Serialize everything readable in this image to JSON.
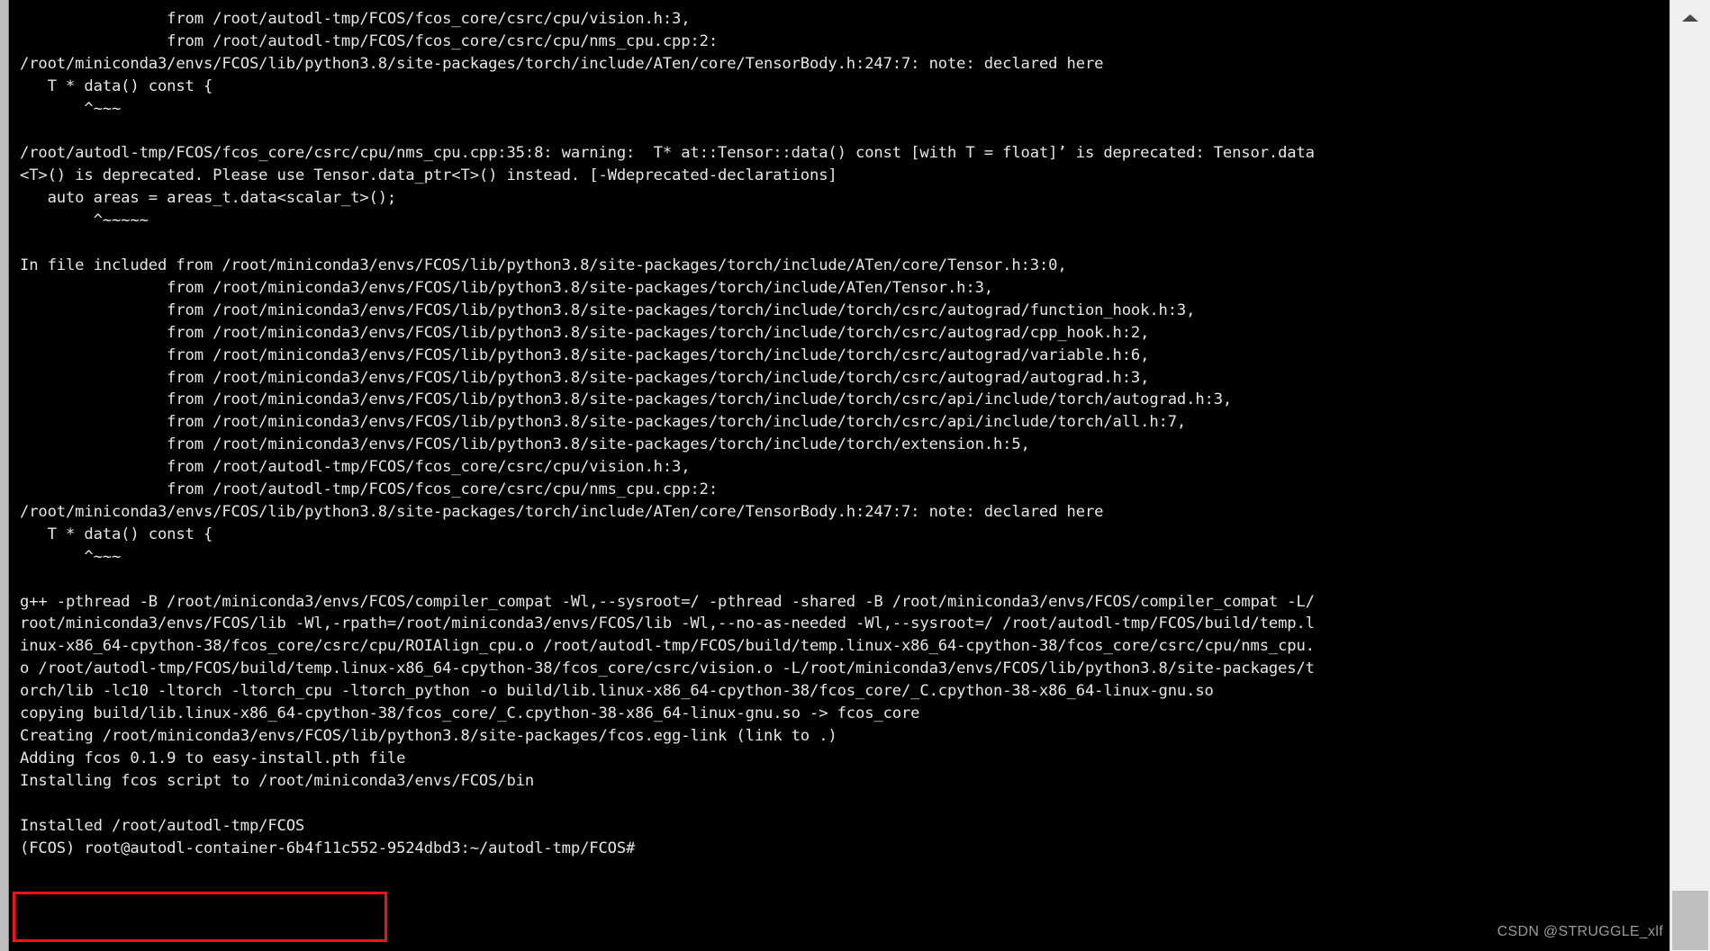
{
  "window": {
    "background_color": "#000000",
    "foreground_color": "#e6e6e6",
    "chrome_color": "#c0c0c0"
  },
  "scrollbar": {
    "up_arrow_label": "▲",
    "thumb_color": "#bfbfbf",
    "track_color": "#f0f0f0"
  },
  "annotation": {
    "color": "#fb0f0f",
    "target_text": "Installed /root/autodl-tmp/FCOS"
  },
  "watermark": {
    "text": "CSDN @STRUGGLE_xlf"
  },
  "terminal": {
    "lines": [
      "                from /root/autodl-tmp/FCOS/fcos_core/csrc/cpu/vision.h:3,",
      "                from /root/autodl-tmp/FCOS/fcos_core/csrc/cpu/nms_cpu.cpp:2:",
      "/root/miniconda3/envs/FCOS/lib/python3.8/site-packages/torch/include/ATen/core/TensorBody.h:247:7: note: declared here",
      "   T * data() const {",
      "       ^~~~",
      "",
      "/root/autodl-tmp/FCOS/fcos_core/csrc/cpu/nms_cpu.cpp:35:8: warning:  T* at::Tensor::data() const [with T = float]’ is deprecated: Tensor.data",
      "<T>() is deprecated. Please use Tensor.data_ptr<T>() instead. [-Wdeprecated-declarations]",
      "   auto areas = areas_t.data<scalar_t>();",
      "        ^~~~~~",
      "",
      "In file included from /root/miniconda3/envs/FCOS/lib/python3.8/site-packages/torch/include/ATen/core/Tensor.h:3:0,",
      "                from /root/miniconda3/envs/FCOS/lib/python3.8/site-packages/torch/include/ATen/Tensor.h:3,",
      "                from /root/miniconda3/envs/FCOS/lib/python3.8/site-packages/torch/include/torch/csrc/autograd/function_hook.h:3,",
      "                from /root/miniconda3/envs/FCOS/lib/python3.8/site-packages/torch/include/torch/csrc/autograd/cpp_hook.h:2,",
      "                from /root/miniconda3/envs/FCOS/lib/python3.8/site-packages/torch/include/torch/csrc/autograd/variable.h:6,",
      "                from /root/miniconda3/envs/FCOS/lib/python3.8/site-packages/torch/include/torch/csrc/autograd/autograd.h:3,",
      "                from /root/miniconda3/envs/FCOS/lib/python3.8/site-packages/torch/include/torch/csrc/api/include/torch/autograd.h:3,",
      "                from /root/miniconda3/envs/FCOS/lib/python3.8/site-packages/torch/include/torch/csrc/api/include/torch/all.h:7,",
      "                from /root/miniconda3/envs/FCOS/lib/python3.8/site-packages/torch/include/torch/extension.h:5,",
      "                from /root/autodl-tmp/FCOS/fcos_core/csrc/cpu/vision.h:3,",
      "                from /root/autodl-tmp/FCOS/fcos_core/csrc/cpu/nms_cpu.cpp:2:",
      "/root/miniconda3/envs/FCOS/lib/python3.8/site-packages/torch/include/ATen/core/TensorBody.h:247:7: note: declared here",
      "   T * data() const {",
      "       ^~~~",
      "",
      "g++ -pthread -B /root/miniconda3/envs/FCOS/compiler_compat -Wl,--sysroot=/ -pthread -shared -B /root/miniconda3/envs/FCOS/compiler_compat -L/",
      "root/miniconda3/envs/FCOS/lib -Wl,-rpath=/root/miniconda3/envs/FCOS/lib -Wl,--no-as-needed -Wl,--sysroot=/ /root/autodl-tmp/FCOS/build/temp.l",
      "inux-x86_64-cpython-38/fcos_core/csrc/cpu/ROIAlign_cpu.o /root/autodl-tmp/FCOS/build/temp.linux-x86_64-cpython-38/fcos_core/csrc/cpu/nms_cpu.",
      "o /root/autodl-tmp/FCOS/build/temp.linux-x86_64-cpython-38/fcos_core/csrc/vision.o -L/root/miniconda3/envs/FCOS/lib/python3.8/site-packages/t",
      "orch/lib -lc10 -ltorch -ltorch_cpu -ltorch_python -o build/lib.linux-x86_64-cpython-38/fcos_core/_C.cpython-38-x86_64-linux-gnu.so",
      "copying build/lib.linux-x86_64-cpython-38/fcos_core/_C.cpython-38-x86_64-linux-gnu.so -> fcos_core",
      "Creating /root/miniconda3/envs/FCOS/lib/python3.8/site-packages/fcos.egg-link (link to .)",
      "Adding fcos 0.1.9 to easy-install.pth file",
      "Installing fcos script to /root/miniconda3/envs/FCOS/bin",
      "",
      "Installed /root/autodl-tmp/FCOS",
      "(FCOS) root@autodl-container-6b4f11c552-9524dbd3:~/autodl-tmp/FCOS#"
    ]
  }
}
